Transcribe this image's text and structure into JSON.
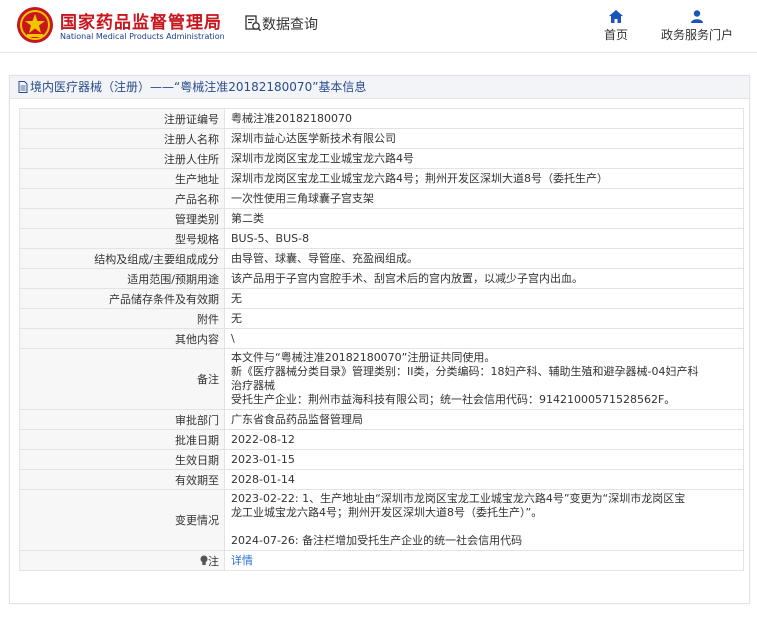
{
  "header": {
    "brand_cn": "国家药品监督管理局",
    "brand_en": "National Medical Products Administration",
    "data_query": "数据查询",
    "nav": [
      {
        "label": "首页",
        "icon": "home-icon"
      },
      {
        "label": "政务服务门户",
        "icon": "user-icon"
      }
    ]
  },
  "panel": {
    "title": "境内医疗器械（注册）——“粤械注准20182180070”基本信息"
  },
  "rows": [
    {
      "label": "注册证编号",
      "value": "粤械注准20182180070"
    },
    {
      "label": "注册人名称",
      "value": "深圳市益心达医学新技术有限公司"
    },
    {
      "label": "注册人住所",
      "value": "深圳市龙岗区宝龙工业城宝龙六路4号"
    },
    {
      "label": "生产地址",
      "value": "深圳市龙岗区宝龙工业城宝龙六路4号；荆州开发区深圳大道8号（委托生产）"
    },
    {
      "label": "产品名称",
      "value": "一次性使用三角球囊子宫支架"
    },
    {
      "label": "管理类别",
      "value": "第二类"
    },
    {
      "label": "型号规格",
      "value": "BUS-5、BUS-8"
    },
    {
      "label": "结构及组成/主要组成成分",
      "value": "由导管、球囊、导管座、充盈阀组成。"
    },
    {
      "label": "适用范围/预期用途",
      "value": "该产品用于子宫内宫腔手术、刮宫术后的宫内放置，以减少子宫内出血。"
    },
    {
      "label": "产品储存条件及有效期",
      "value": "无"
    },
    {
      "label": "附件",
      "value": "无"
    },
    {
      "label": "其他内容",
      "value": "\\"
    },
    {
      "label": "备注",
      "lines": [
        "本文件与“粤械注准20182180070”注册证共同使用。",
        "新《医疗器械分类目录》管理类别：II类，分类编码：18妇产科、辅助生殖和避孕器械-04妇产科",
        "治疗器械",
        "受托生产企业：荆州市益海科技有限公司；统一社会信用代码：91421000571528562F。"
      ]
    },
    {
      "label": "审批部门",
      "value": "广东省食品药品监督管理局"
    },
    {
      "label": "批准日期",
      "value": "2022-08-12"
    },
    {
      "label": "生效日期",
      "value": "2023-01-15"
    },
    {
      "label": "有效期至",
      "value": "2028-01-14"
    },
    {
      "label": "变更情况",
      "lines": [
        "2023-02-22: 1、生产地址由“深圳市龙岗区宝龙工业城宝龙六路4号”变更为“深圳市龙岗区宝",
        "龙工业城宝龙六路4号；荆州开发区深圳大道8号（委托生产）”。",
        "",
        "2024-07-26: 备注栏增加受托生产企业的统一社会信用代码"
      ]
    }
  ],
  "note": {
    "label": "注",
    "link": "详情"
  },
  "colors": {
    "brand_red": "#c8161d",
    "brand_blue": "#1a3e8c",
    "link_blue": "#2a6fdb",
    "title_blue": "#2a4c8c"
  }
}
